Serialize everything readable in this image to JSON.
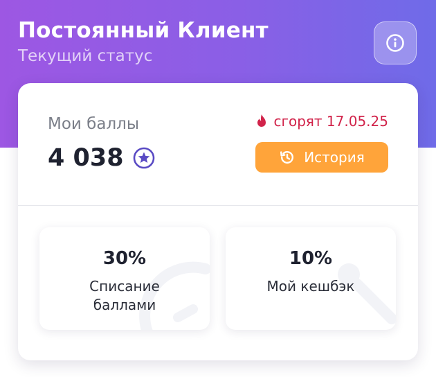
{
  "header": {
    "title": "Постоянный Клиент",
    "subtitle": "Текущий статус",
    "info_icon": "info-icon"
  },
  "points": {
    "label": "Мои баллы",
    "value": "4 038",
    "currency_icon": "star-coin-icon",
    "expire_icon": "flame-icon",
    "expire_text": "сгорят 17.05.25",
    "history_icon": "history-clock-icon",
    "history_label": "История"
  },
  "tiles": [
    {
      "value": "30%",
      "label": "Списание\nбаллами"
    },
    {
      "value": "10%",
      "label": "Мой кешбэк"
    }
  ],
  "colors": {
    "header_gradient_start": "#9d57e3",
    "header_gradient_end": "#6f6be8",
    "accent_orange": "#ffa43a",
    "expire_red": "#d1234a",
    "star_purple": "#5a4bc4"
  }
}
